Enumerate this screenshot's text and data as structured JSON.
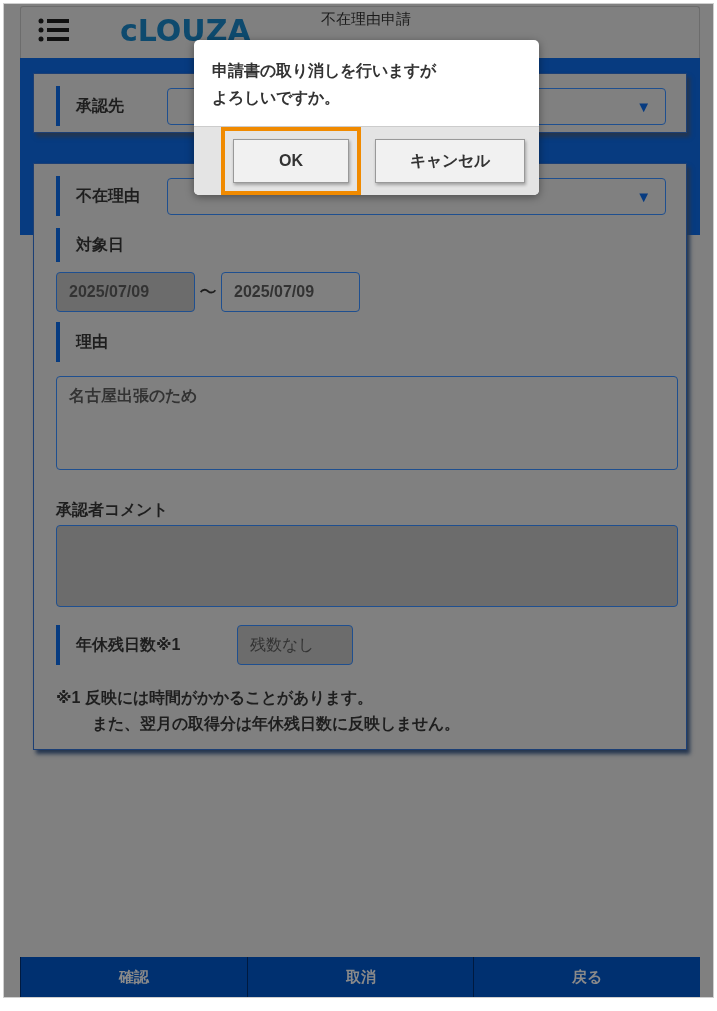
{
  "header": {
    "logo": "cLOUZA",
    "title": "不在理由申請"
  },
  "form": {
    "approver": {
      "label": "承認先",
      "arrow": "▼"
    },
    "reason_type": {
      "label": "不在理由",
      "arrow": "▼"
    },
    "target_date": {
      "label": "対象日",
      "from": "2025/07/09",
      "from_disabled": true,
      "separator": "〜",
      "to": "2025/07/09"
    },
    "reason": {
      "label": "理由",
      "value": "名古屋出張のため"
    },
    "comment": {
      "label": "承認者コメント",
      "disabled": true
    },
    "leave": {
      "label": "年休残日数※1",
      "value": "残数なし"
    },
    "notes": [
      "※1 反映には時間がかかることがあります。",
      "また、翌月の取得分は年休残日数に反映しません。"
    ]
  },
  "footer": [
    {
      "label": "確認"
    },
    {
      "label": "取消"
    },
    {
      "label": "戻る"
    }
  ],
  "dialog": {
    "message": [
      "申請書の取り消しを行いますが",
      "よろしいですか。"
    ],
    "buttons": [
      {
        "label": "OK",
        "focused": true
      },
      {
        "label": "キャンセル",
        "focused": false
      }
    ]
  }
}
